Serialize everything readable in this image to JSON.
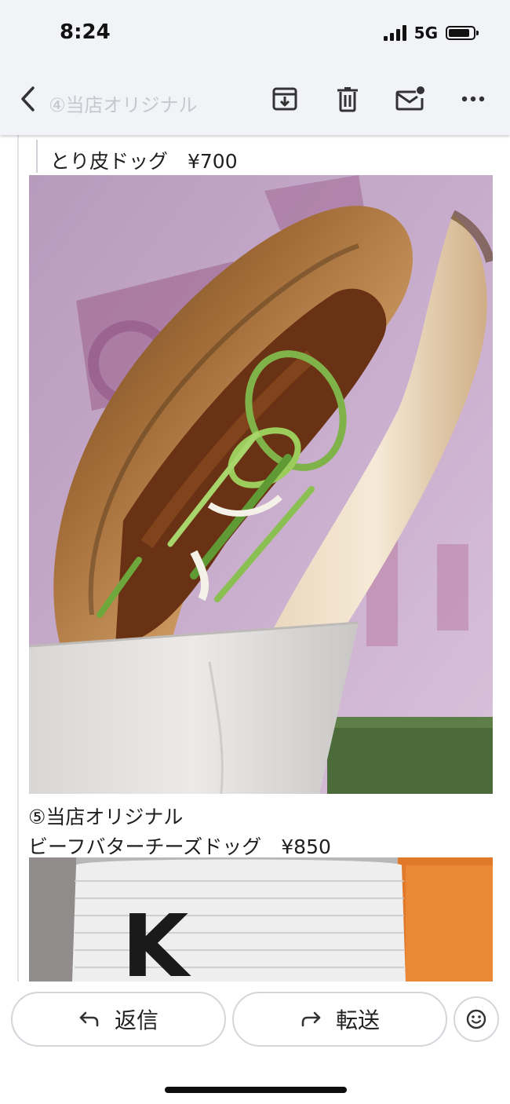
{
  "status_bar": {
    "time": "8:24",
    "network": "5G",
    "battery_level": 0.85
  },
  "toolbar": {
    "subject_preview": "④当店オリジナル",
    "icons": [
      "back-icon",
      "archive-icon",
      "delete-icon",
      "mark-unread-icon",
      "more-icon"
    ]
  },
  "message": {
    "item4_title": "とり皮ドッグ　¥700",
    "item5_line1": "⑤当店オリジナル",
    "item5_line2": "ビーフバターチーズドッグ　¥850",
    "next_image_letter": "K"
  },
  "actions": {
    "reply_label": "返信",
    "forward_label": "転送",
    "icons": [
      "reply-icon",
      "forward-icon",
      "emoji-icon"
    ]
  },
  "colors": {
    "toolbar_bg": "#f1f3f7",
    "accent_dark": "#1f1f1f",
    "button_border": "#d3d6da"
  }
}
